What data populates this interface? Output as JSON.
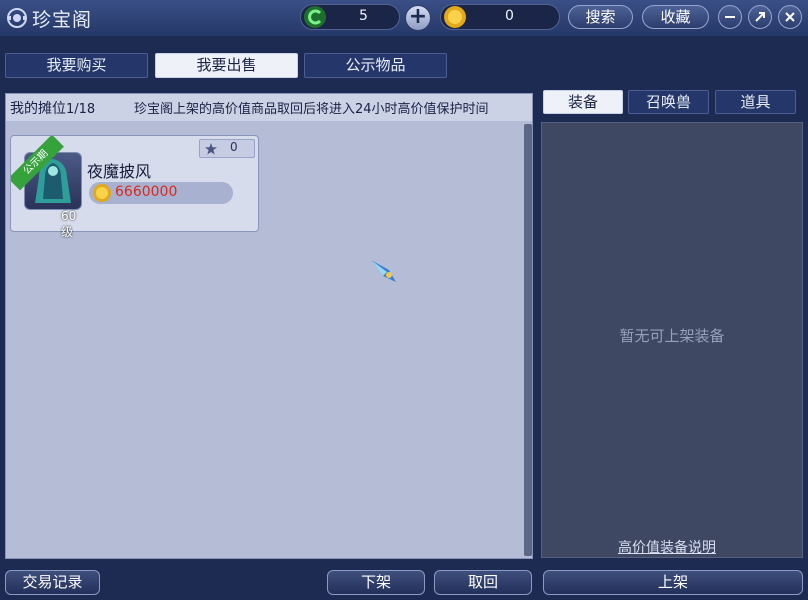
{
  "window": {
    "title": "珍宝阁"
  },
  "currency": [
    {
      "name": "green-orb",
      "value": "5"
    },
    {
      "name": "gold-coin",
      "value": "0"
    }
  ],
  "header_buttons": {
    "search": "搜索",
    "favorite": "收藏"
  },
  "tabs": [
    {
      "label": "我要购买",
      "active": false
    },
    {
      "label": "我要出售",
      "active": true
    },
    {
      "label": "公示物品",
      "active": false
    }
  ],
  "stall": {
    "title": "我的摊位",
    "count": "1/18",
    "note": "珍宝阁上架的高价值商品取回后将进入24小时高价值保护时间",
    "items": [
      {
        "name": "夜魔披风",
        "price": "6660000",
        "level": "60级",
        "badge": "公示期",
        "stars": "0",
        "icon": "cloak-icon"
      }
    ]
  },
  "right_tabs": [
    {
      "label": "装备",
      "active": true
    },
    {
      "label": "召唤兽",
      "active": false
    },
    {
      "label": "道具",
      "active": false
    }
  ],
  "equip": {
    "empty_text": "暂无可上架装备",
    "help_link": "高价值装备说明"
  },
  "bottom_buttons": {
    "history": "交易记录",
    "unlist": "下架",
    "retrieve": "取回",
    "list": "上架"
  },
  "colors": {
    "price": "#d62b1f",
    "badge": "#36a23c",
    "background": "#1d2a52"
  }
}
